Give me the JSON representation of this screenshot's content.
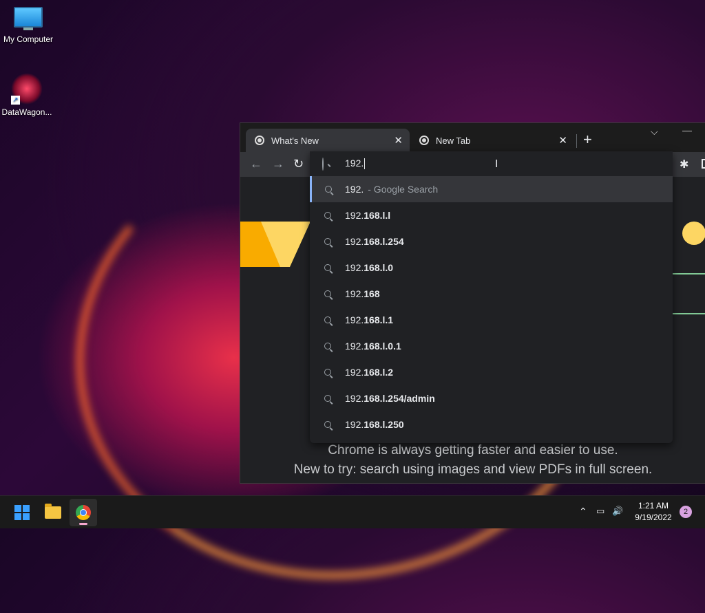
{
  "desktop": {
    "icons": [
      {
        "label": "My Computer",
        "icon": "monitor-icon"
      },
      {
        "label": "DataWagon...",
        "icon": "datawagon-icon"
      }
    ]
  },
  "browser": {
    "tabs": [
      {
        "title": "What's New",
        "active": true
      },
      {
        "title": "New Tab",
        "active": false
      }
    ],
    "new_tab": "+",
    "close_glyph": "✕",
    "tab_menu_glyph": "⌵",
    "minimize_glyph": "—",
    "nav": {
      "back": "←",
      "forward": "→",
      "reload": "↻"
    },
    "omnibox": {
      "typed": "192.",
      "suggestions": [
        {
          "prefix": "192.",
          "bold": "",
          "hint": "- Google Search",
          "selected": true
        },
        {
          "prefix": "192.",
          "bold": "168.l.l",
          "hint": ""
        },
        {
          "prefix": "192.",
          "bold": "168.l.254",
          "hint": ""
        },
        {
          "prefix": "192.",
          "bold": "168.l.0",
          "hint": ""
        },
        {
          "prefix": "192.",
          "bold": "168",
          "hint": ""
        },
        {
          "prefix": "192.",
          "bold": "168.l.1",
          "hint": ""
        },
        {
          "prefix": "192.",
          "bold": "168.l.0.1",
          "hint": ""
        },
        {
          "prefix": "192.",
          "bold": "168.l.2",
          "hint": ""
        },
        {
          "prefix": "192.",
          "bold": "168.l.254/admin",
          "hint": ""
        },
        {
          "prefix": "192.",
          "bold": "168.l.250",
          "hint": ""
        }
      ]
    },
    "page": {
      "line1": "Chrome is always getting faster and easier to use.",
      "line2": "New to try: search using images and view PDFs in full screen."
    }
  },
  "taskbar": {
    "time": "1:21 AM",
    "date": "9/19/2022",
    "notifications": "2",
    "tray_chevron": "⌃",
    "volume_glyph": "🔊",
    "colors": {
      "accent": "#3aa0ff",
      "selection_bar": "#8ab4f8"
    }
  }
}
